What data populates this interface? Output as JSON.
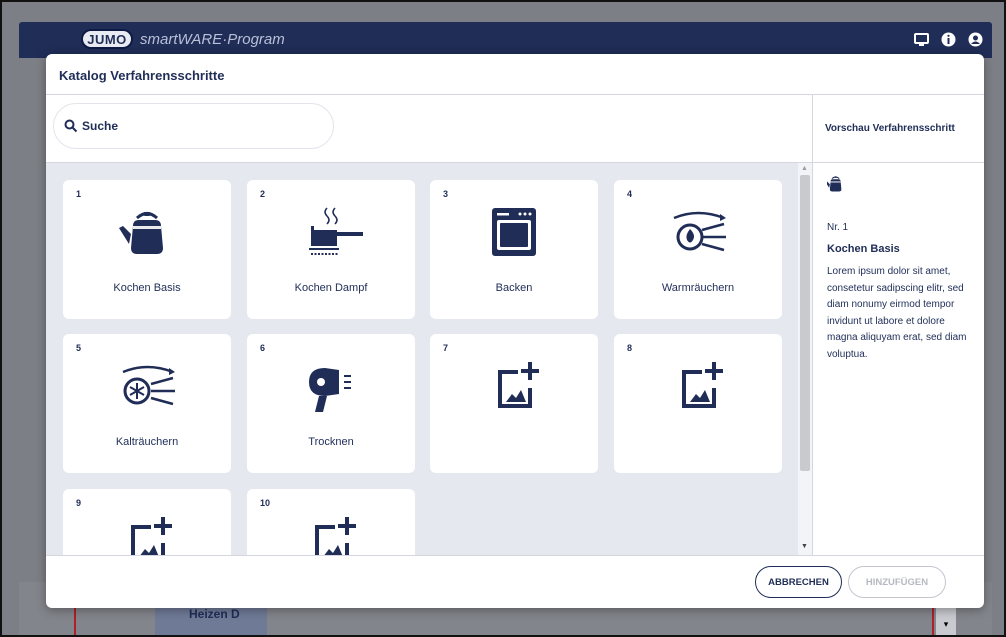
{
  "app": {
    "logo": "JUMO",
    "title": "smartWARE·Program"
  },
  "background": {
    "tab_label": "Heizen D"
  },
  "dialog": {
    "title": "Katalog Verfahrensschritte",
    "search_placeholder": "Suche",
    "preview": {
      "header": "Vorschau Verfahrensschritt",
      "icon": "kettle-icon",
      "nr": "Nr. 1",
      "name": "Kochen Basis",
      "description": "Lorem ipsum dolor sit amet, consetetur sadipscing elitr, sed diam nonumy eirmod tempor invidunt ut labore et dolore magna aliquyam erat, sed diam voluptua."
    },
    "cards": [
      {
        "num": "1",
        "label": "Kochen Basis",
        "icon": "kettle-icon"
      },
      {
        "num": "2",
        "label": "Kochen Dampf",
        "icon": "steaming-pot-icon"
      },
      {
        "num": "3",
        "label": "Backen",
        "icon": "oven-icon"
      },
      {
        "num": "4",
        "label": "Warmräuchern",
        "icon": "warm-smoke-icon"
      },
      {
        "num": "5",
        "label": "Kalträuchern",
        "icon": "cold-smoke-icon"
      },
      {
        "num": "6",
        "label": "Trocknen",
        "icon": "hair-dryer-icon"
      },
      {
        "num": "7",
        "label": "",
        "icon": "add-image-icon"
      },
      {
        "num": "8",
        "label": "",
        "icon": "add-image-icon"
      },
      {
        "num": "9",
        "label": "",
        "icon": "add-image-icon"
      },
      {
        "num": "10",
        "label": "",
        "icon": "add-image-icon"
      }
    ],
    "buttons": {
      "cancel": "ABBRECHEN",
      "add": "HINZUFÜGEN"
    }
  },
  "colors": {
    "navy": "#1f2d57",
    "grid_bg": "#e5e8ee",
    "accent_red": "#b0202a"
  }
}
